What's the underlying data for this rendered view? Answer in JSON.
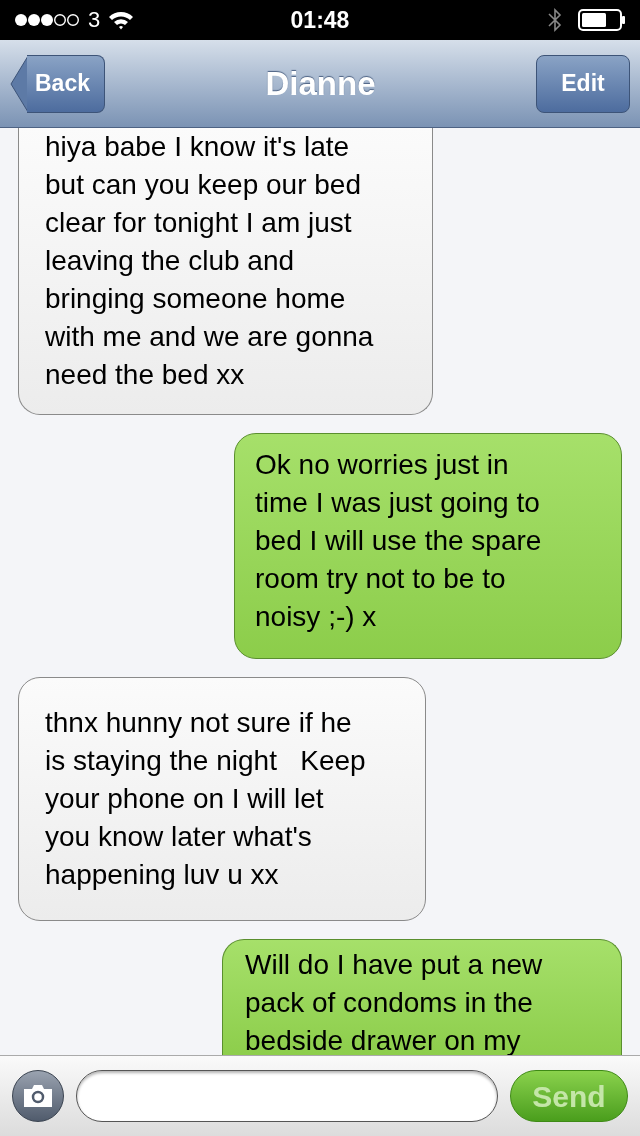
{
  "status_bar": {
    "carrier": "3",
    "time": "01:48"
  },
  "nav_bar": {
    "back": "Back",
    "title": "Dianne",
    "edit": "Edit"
  },
  "messages": [
    {
      "kind": "received",
      "text": "hiya babe I know it's late\nbut can you keep our bed\nclear for tonight I am just\nleaving the club and\nbringing someone home\nwith me and we are gonna\nneed the bed xx"
    },
    {
      "kind": "sent",
      "text": "Ok no worries just in\ntime I was just going to\nbed I will use the spare\nroom try not to be to\nnoisy ;-) x"
    },
    {
      "kind": "received",
      "text": "thnx hunny not sure if he\nis staying the night   Keep\nyour phone on I will let\nyou know later what's\nhappening luv u xx"
    },
    {
      "kind": "sent",
      "text": "Will do I have put a new\npack of condoms in the\nbedside drawer on my"
    }
  ],
  "composer": {
    "send": "Send",
    "disabled": true
  }
}
